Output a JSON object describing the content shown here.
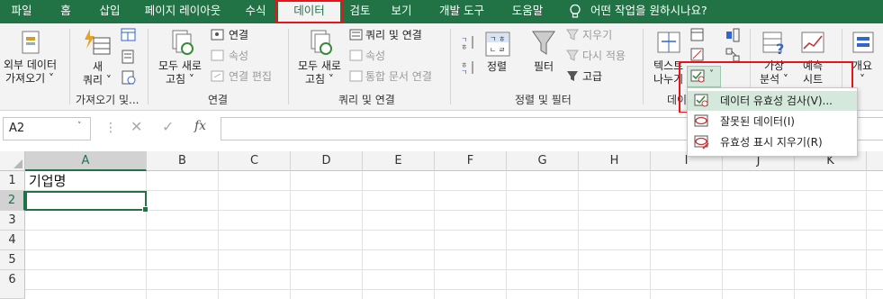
{
  "tabs": [
    {
      "label": "파일"
    },
    {
      "label": "홈"
    },
    {
      "label": "삽입"
    },
    {
      "label": "페이지 레이아웃"
    },
    {
      "label": "수식"
    },
    {
      "label": "데이터"
    },
    {
      "label": "검토"
    },
    {
      "label": "보기"
    },
    {
      "label": "개발 도구"
    },
    {
      "label": "도움말"
    }
  ],
  "tell_me": "어떤 작업을 원하시나요?",
  "ribbon": {
    "external_data": {
      "line1": "외부 데이터",
      "line2": "가져오기 ˅"
    },
    "new_query": {
      "line1": "새",
      "line2": "쿼리 ˅"
    },
    "group_get_transform": "가져오기 및...",
    "refresh_all_1": {
      "line1": "모두 새로",
      "line2": "고침 ˅"
    },
    "connections": "연결",
    "properties": "속성",
    "edit_links": "연결 편집",
    "group_connections": "연결",
    "refresh_all_2": {
      "line1": "모두 새로",
      "line2": "고침 ˅"
    },
    "queries_connections": "쿼리 및 연결",
    "properties_2": "속성",
    "workbook_links": "통합 문서 연결",
    "group_queries_connections": "쿼리 및 연결",
    "sort": "정렬",
    "filter": "필터",
    "clear": "지우기",
    "reapply": "다시 적용",
    "advanced": "고급",
    "group_sort_filter": "정렬 및 필터",
    "text_to_columns": {
      "line1": "텍스트",
      "line2": "나누기"
    },
    "group_data_tools_partial": "데이",
    "whatif": {
      "line1": "가상",
      "line2": "분석 ˅"
    },
    "forecast": {
      "line1": "예측",
      "line2": "시트"
    },
    "outline": {
      "line1": "개요",
      "line2": "˅"
    }
  },
  "formula_bar": {
    "name_box": "A2",
    "formula": ""
  },
  "columns": [
    "A",
    "B",
    "C",
    "D",
    "E",
    "F",
    "G",
    "H",
    "I",
    "J",
    "K"
  ],
  "rows": [
    "1",
    "2",
    "3",
    "4",
    "5",
    "6"
  ],
  "cells": {
    "A1": "기업명",
    "A2": ""
  },
  "dropdown": {
    "items": [
      {
        "label": "데이터 유효성 검사(V)..."
      },
      {
        "label": "잘못된 데이터(I)"
      },
      {
        "label": "유효성 표시 지우기(R)"
      }
    ]
  },
  "colors": {
    "accent": "#217346",
    "highlight": "#e8141c",
    "menu_hover": "#d4e9dc"
  }
}
